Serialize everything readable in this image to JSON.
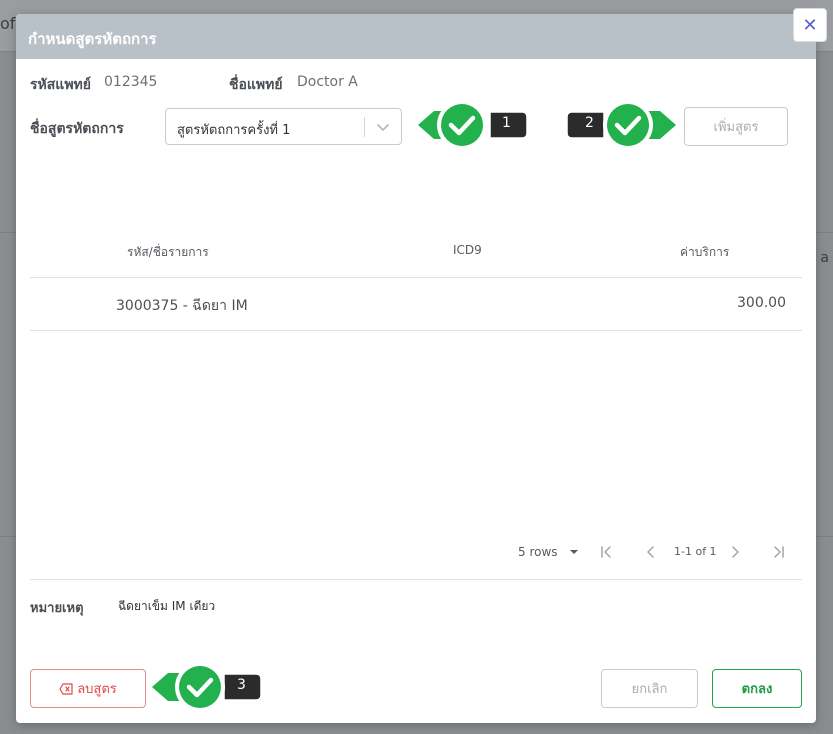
{
  "background": {
    "top_text": "of",
    "side_char": "a"
  },
  "modal": {
    "title": "กำหนดสูตรหัตถการ",
    "close_symbol": "✕"
  },
  "doctor": {
    "code_label": "รหัสแพทย์",
    "code_value": "012345",
    "name_label": "ชื่อแพทย์",
    "name_value": "Doctor A"
  },
  "formula": {
    "label": "ชื่อสูตรหัตถการ",
    "selected": "สูตรหัตถการครั้งที่ 1",
    "add_button": "เพิ่มสูตร"
  },
  "table": {
    "columns": [
      "รหัส/ชื่อรายการ",
      "ICD9",
      "ค่าบริการ"
    ],
    "rows": [
      {
        "item": "3000375 - ฉีดยา IM",
        "icd9": "",
        "price": "300.00"
      }
    ]
  },
  "pagination": {
    "rows_per_page": "5 rows",
    "range": "1-1 of 1"
  },
  "note": {
    "label": "หมายเหตุ",
    "value": "ฉีดยาเข็ม IM เดียว"
  },
  "footer": {
    "delete_label": "ลบสูตร",
    "cancel_label": "ยกเลิก",
    "ok_label": "ตกลง"
  },
  "steps": {
    "one": "1",
    "two": "2",
    "three": "3"
  },
  "colors": {
    "header": "#b8c0c8",
    "primary_green": "#1f9a45",
    "danger_red": "#dc4a4a",
    "badge_dark": "#2b2b2b",
    "check_green": "#22b14c"
  },
  "icons": {
    "close": "close-icon",
    "dropdown": "chevron-down-icon",
    "delete": "backspace-icon",
    "first_page": "first-page-icon",
    "prev_page": "chevron-left-icon",
    "next_page": "chevron-right-icon",
    "last_page": "last-page-icon",
    "step_check": "check-circle-icon"
  }
}
